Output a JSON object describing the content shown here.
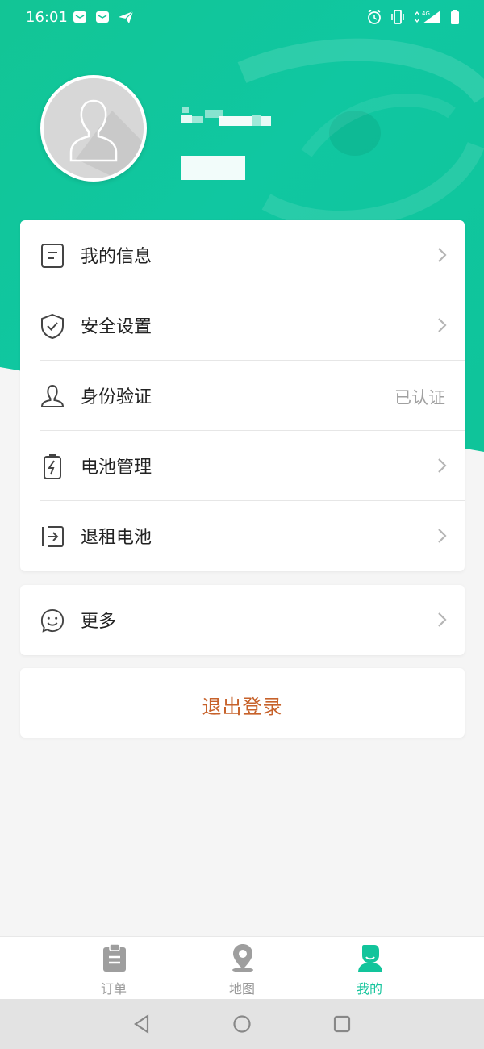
{
  "status_bar": {
    "time": "16:01",
    "network": "4G",
    "left_icons": [
      "mail-icon",
      "mail-icon",
      "send-icon"
    ],
    "right_icons": [
      "alarm-icon",
      "vibrate-icon",
      "data-arrows-icon",
      "signal-icon",
      "battery-icon"
    ]
  },
  "profile": {
    "avatar_icon": "default-avatar-icon"
  },
  "menu": {
    "items": [
      {
        "label": "我的信息",
        "icon": "document-icon"
      },
      {
        "label": "安全设置",
        "icon": "shield-check-icon"
      },
      {
        "label": "身份验证",
        "icon": "person-icon",
        "status": "已认证"
      },
      {
        "label": "电池管理",
        "icon": "battery-charge-icon"
      },
      {
        "label": "退租电池",
        "icon": "exit-icon"
      }
    ],
    "more": {
      "label": "更多",
      "icon": "smile-icon"
    }
  },
  "logout": {
    "label": "退出登录"
  },
  "tabbar": {
    "tabs": [
      {
        "label": "订单",
        "icon": "clipboard-icon"
      },
      {
        "label": "地图",
        "icon": "location-pin-icon"
      },
      {
        "label": "我的",
        "icon": "user-icon",
        "active": true
      }
    ]
  },
  "nav": {
    "buttons": [
      "back-icon",
      "home-icon",
      "recents-icon"
    ]
  },
  "colors": {
    "accent_green": "#12c49b",
    "logout_orange": "#c7622b",
    "background": "#f5f5f5"
  }
}
